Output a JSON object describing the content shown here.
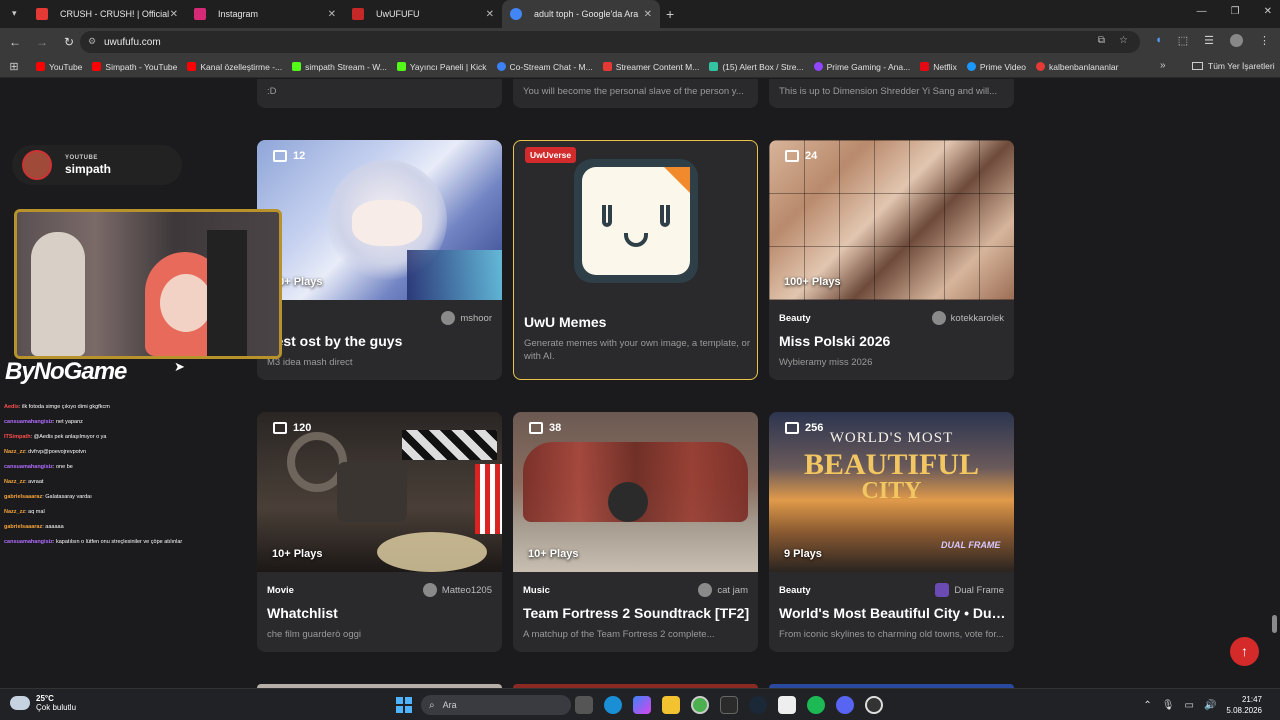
{
  "tabs": [
    {
      "title": "CRUSH - CRUSH! | Official Music",
      "favicon_color": "#e53935"
    },
    {
      "title": "Instagram",
      "favicon_color": "#d62976"
    },
    {
      "title": "UwUFUFU",
      "favicon_color": "#c62828"
    },
    {
      "title": "adult toph - Google'da Ara",
      "favicon_color": "#4285f4"
    }
  ],
  "address": {
    "url": "uwufufu.com"
  },
  "bookmarks": [
    {
      "label": "YouTube",
      "color": "#ff0000"
    },
    {
      "label": "Simpath - YouTube",
      "color": "#ff0000"
    },
    {
      "label": "Kanal özelleştirme -...",
      "color": "#ff0000"
    },
    {
      "label": "simpath Stream - W...",
      "color": "#53fc18"
    },
    {
      "label": "Yayıncı Paneli | Kick",
      "color": "#53fc18"
    },
    {
      "label": "Co-Stream Chat - M...",
      "color": "#3b82f6"
    },
    {
      "label": "Streamer Content M...",
      "color": "#e53935"
    },
    {
      "label": "(15) Alert Box / Stre...",
      "color": "#31c3a2"
    },
    {
      "label": "Prime Gaming - Ana...",
      "color": "#9146ff"
    },
    {
      "label": "Netflix",
      "color": "#e50914"
    },
    {
      "label": "Prime Video",
      "color": "#1a98ff"
    },
    {
      "label": "kalbenbanlananlar",
      "color": "#e53935"
    }
  ],
  "bookmarks_all": "Tüm Yer İşaretleri",
  "top_partial": [
    {
      "desc": ":D"
    },
    {
      "desc": "You will become the personal slave of the person y..."
    },
    {
      "desc": "This is up to Dimension Shredder Yi Sang and will..."
    }
  ],
  "row1": {
    "card1": {
      "count": "12",
      "plays": "10+ Plays",
      "category": "U",
      "author": "mshoor",
      "title": "best ost by the guys",
      "desc": "M3 idea mash direct"
    },
    "uwu": {
      "badge": "UwUverse",
      "title": "UwU Memes",
      "desc": "Generate memes with your own image, a template, or with AI."
    },
    "card3": {
      "count": "24",
      "plays": "100+ Plays",
      "category": "Beauty",
      "author": "kotekkarolek",
      "title": "Miss Polski 2026",
      "desc": "Wybieramy miss 2026"
    }
  },
  "row2": {
    "card1": {
      "count": "120",
      "plays": "10+ Plays",
      "category": "Movie",
      "author": "Matteo1205",
      "title": "Whatchlist",
      "desc": "che film guarderò oggi"
    },
    "card2": {
      "count": "38",
      "plays": "10+ Plays",
      "category": "Music",
      "author": "cat jam",
      "title": "Team Fortress 2 Soundtrack [TF2]",
      "desc": "A matchup of the Team Fortress 2 complete..."
    },
    "card3": {
      "count": "256",
      "plays": "9 Plays",
      "category": "Beauty",
      "author": "Dual Frame",
      "title": "World's Most Beautiful City • Dua...",
      "desc": "From iconic skylines to charming old towns, vote for...",
      "thumb_text_1": "WORLD'S MOST",
      "thumb_text_2": "BEAUTIFUL",
      "thumb_text_3": "CITY",
      "thumb_brand": "DUAL FRAME"
    }
  },
  "stream": {
    "platform": "YOUTUBE",
    "channel": "simpath",
    "sponsor": "ByNoGame",
    "chat": [
      {
        "user": "Aedis",
        "msg": "ilk fotoda simge çıkıyo dimi gkgfkcm",
        "color": "#ff4d4d"
      },
      {
        "user": "cansuamahangisiz",
        "msg": "net yapanz",
        "color": "#b06cff"
      },
      {
        "user": "ITSimpath",
        "msg": "@Aedis pek anlaşılmıyor o ya",
        "color": "#ff4d4d"
      },
      {
        "user": "Nazz_zz",
        "msg": "dvfrvp@poevojrevpotvn",
        "color": "#f4a43b"
      },
      {
        "user": "cansuamahangisiz",
        "msg": "one be",
        "color": "#b06cff"
      },
      {
        "user": "Nazz_zz",
        "msg": "avraat",
        "color": "#f4a43b"
      },
      {
        "user": "gabrielsaaaraz",
        "msg": "Galatasaray vardaı",
        "color": "#f4a43b"
      },
      {
        "user": "Nazz_zz",
        "msg": "aq mal",
        "color": "#f4a43b"
      },
      {
        "user": "gabrielsaaaraz",
        "msg": "aaaaaa",
        "color": "#f4a43b"
      },
      {
        "user": "cansuamahangisiz",
        "msg": "kapatılsın o lütfen onu streçlesiniler ve çöpe atılınlar",
        "color": "#b06cff"
      }
    ]
  },
  "taskbar": {
    "temp": "25°C",
    "weather": "Çok bulutlu",
    "search_placeholder": "Ara",
    "time": "21:47",
    "date": "5.08.2026"
  }
}
